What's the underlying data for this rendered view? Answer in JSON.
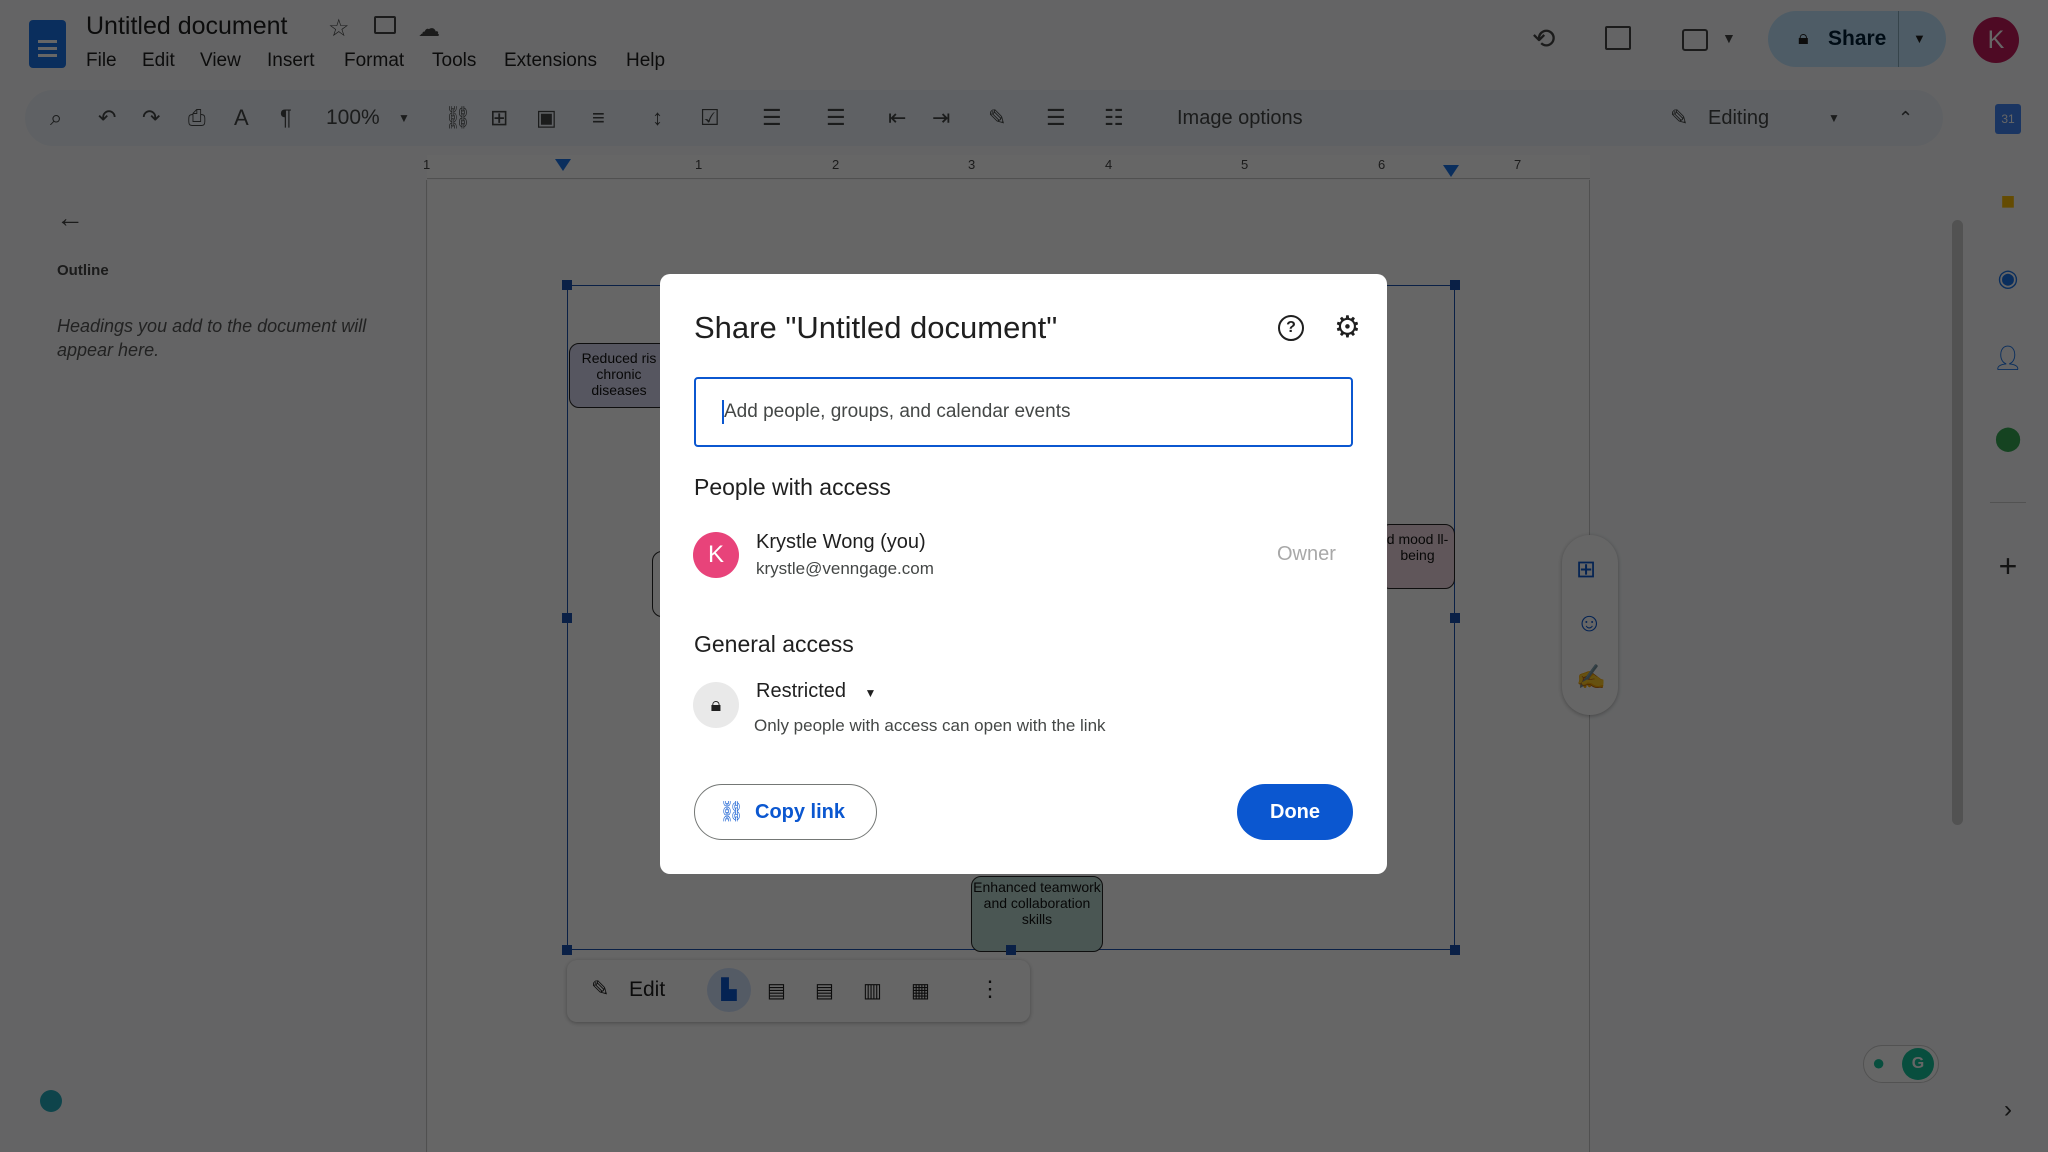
{
  "app": {
    "doc_title": "Untitled document",
    "menu": [
      "File",
      "Edit",
      "View",
      "Insert",
      "Format",
      "Tools",
      "Extensions",
      "Help"
    ],
    "share_label": "Share",
    "avatar_letter": "K",
    "avatar_color": "#e8437a"
  },
  "toolbar": {
    "zoom": "100%",
    "image_options": "Image options",
    "mode": "Editing"
  },
  "ruler": [
    "1",
    "1",
    "2",
    "3",
    "4",
    "5",
    "6",
    "7"
  ],
  "outline": {
    "title": "Outline",
    "empty_text": "Headings you add to the document will appear here."
  },
  "diagram": {
    "box1": "Reduced ris chronic diseases",
    "box2": "d mood ll-being",
    "box3": "Enhanced teamwork and collaboration skills"
  },
  "image_toolbar": {
    "edit": "Edit"
  },
  "dialog": {
    "title": "Share \"Untitled document\"",
    "input_placeholder": "Add people, groups, and calendar events",
    "people_heading": "People with access",
    "person": {
      "initial": "K",
      "name": "Krystle Wong (you)",
      "email": "krystle@venngage.com",
      "role": "Owner"
    },
    "general_heading": "General access",
    "access_level": "Restricted",
    "access_desc": "Only people with access can open with the link",
    "copy_link": "Copy link",
    "done": "Done",
    "accent": "#0b57d0"
  }
}
